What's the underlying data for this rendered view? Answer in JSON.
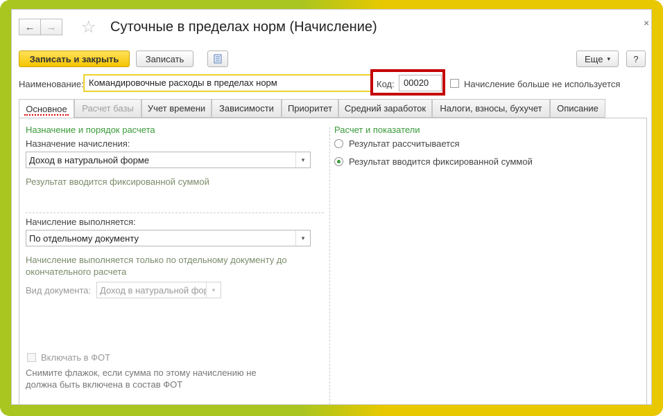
{
  "window": {
    "title": "Суточные в пределах норм (Начисление)",
    "close": "×"
  },
  "nav": {
    "back": "←",
    "forward": "→",
    "favorite": "☆"
  },
  "toolbar": {
    "save_close": "Записать и закрыть",
    "save": "Записать",
    "report_icon": "list-icon",
    "more": "Еще",
    "more_arrow": "▾",
    "help": "?"
  },
  "form": {
    "name_label": "Наименование:",
    "name_value": "Командировочные расходы в пределах норм",
    "code_label": "Код:",
    "code_value": "00020",
    "not_used_label": "Начисление больше не используется"
  },
  "tabs": [
    {
      "label": "Основное"
    },
    {
      "label": "Расчет базы"
    },
    {
      "label": "Учет времени"
    },
    {
      "label": "Зависимости"
    },
    {
      "label": "Приоритет"
    },
    {
      "label": "Средний заработок"
    },
    {
      "label": "Налоги, взносы, бухучет"
    },
    {
      "label": "Описание"
    }
  ],
  "left": {
    "section_title": "Назначение и порядок расчета",
    "purpose_label": "Назначение начисления:",
    "purpose_value": "Доход в натуральной форме",
    "purpose_hint": "Результат вводится фиксированной суммой",
    "exec_label": "Начисление выполняется:",
    "exec_value": "По отдельному документу",
    "exec_hint": "Начисление выполняется только по отдельному документу до окончательного расчета",
    "doc_type_label": "Вид документа:",
    "doc_type_value": "Доход в натуральной фор",
    "fot_label": "Включать в ФОТ",
    "fot_hint": "Снимите флажок, если сумма по этому начислению не должна быть включена в состав ФОТ"
  },
  "right": {
    "section_title": "Расчет и показатели",
    "radio_calc": "Результат рассчитывается",
    "radio_fixed": "Результат вводится фиксированной суммой"
  }
}
